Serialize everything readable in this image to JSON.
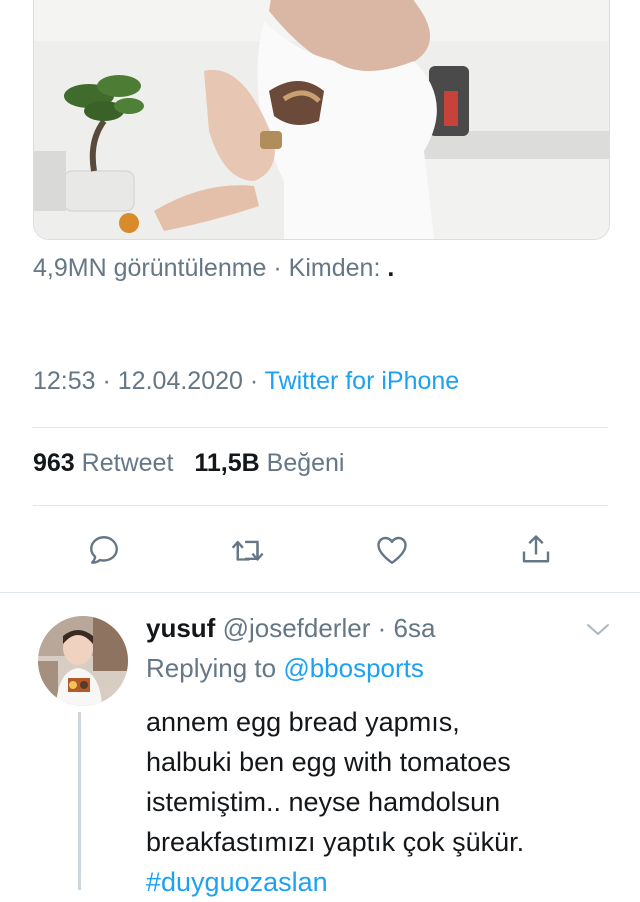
{
  "tweet": {
    "views_text": "4,9MN görüntülenme · Kimden:",
    "from_dot": ".",
    "time": "12:53",
    "date": "12.04.2020",
    "separator": " · ",
    "source": "Twitter for iPhone",
    "retweet_count": "963",
    "retweet_label": "Retweet",
    "like_count": "11,5B",
    "like_label": "Beğeni"
  },
  "actions": [
    {
      "icon": "reply-icon"
    },
    {
      "icon": "retweet-icon"
    },
    {
      "icon": "like-icon"
    },
    {
      "icon": "share-icon"
    }
  ],
  "reply": {
    "name": "yusuf",
    "handle": "@josefderler",
    "age": "6sa",
    "replying_label": "Replying to",
    "replying_to": "@bbosports",
    "text_lines": [
      "annem egg bread yapmıs,",
      "halbuki ben egg with tomatoes",
      "istemiştim.. neyse hamdolsun",
      "breakfastımızı yaptık çok şükür."
    ],
    "hashtag": "#duyguozaslan"
  },
  "colors": {
    "accent": "#1da1f2",
    "text_primary": "#14171a",
    "text_secondary": "#657786",
    "divider": "#e1e8ed"
  }
}
